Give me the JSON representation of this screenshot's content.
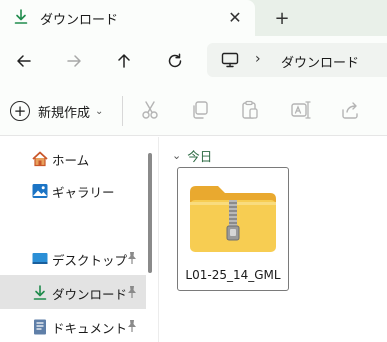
{
  "tab": {
    "title": "ダウンロード",
    "close_glyph": "✕",
    "new_tab_glyph": "+"
  },
  "nav": {
    "breadcrumb": "ダウンロード",
    "separator": "›"
  },
  "toolbar": {
    "new_label": "新規作成",
    "new_caret": "⌄"
  },
  "sidebar": {
    "items": [
      {
        "label": "ホーム",
        "icon": "home-icon"
      },
      {
        "label": "ギャラリー",
        "icon": "gallery-icon"
      },
      {
        "label": "デスクトップ",
        "icon": "desktop-icon",
        "pinned": true
      },
      {
        "label": "ダウンロード",
        "icon": "download-icon",
        "pinned": true,
        "active": true
      },
      {
        "label": "ドキュメント",
        "icon": "documents-icon",
        "pinned": true
      }
    ]
  },
  "content": {
    "group_label": "今日",
    "group_chevron": "⌄",
    "files": [
      {
        "name": "L01-25_14_GML",
        "icon": "zip-folder-icon"
      }
    ]
  },
  "colors": {
    "accent": "#1f8b4c",
    "tab_strip": "#e9f0e9",
    "selected": "#e3e3e3",
    "folder": "#f5c542"
  }
}
